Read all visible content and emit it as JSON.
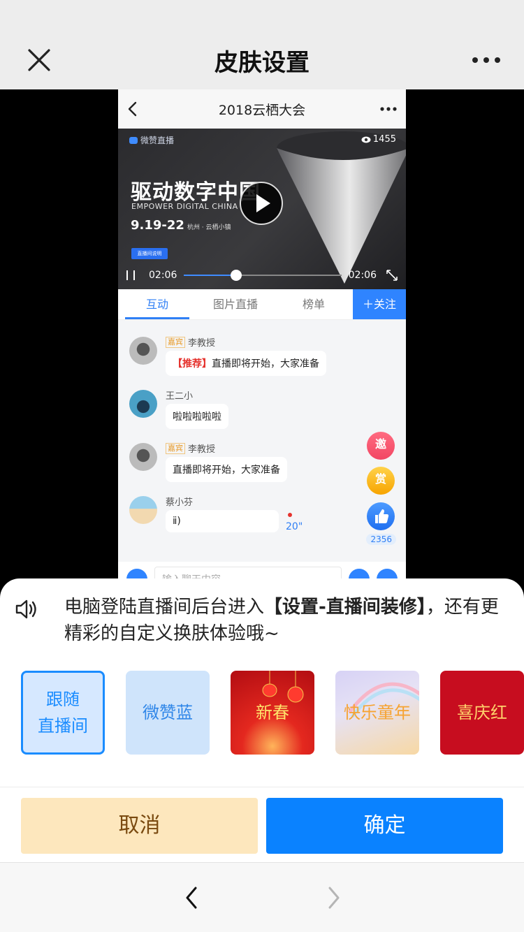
{
  "nav": {
    "title": "皮肤设置"
  },
  "preview": {
    "title": "2018云栖大会",
    "video": {
      "brand": "微赞直播",
      "viewers": "1455",
      "headline": "驱动数字中国",
      "subtitle_en": "EMPOWER DIGITAL CHINA",
      "date": "9.19-22",
      "location": "杭州 · 云栖小镇",
      "tag_button": "直播间说明",
      "time_current": "02:06",
      "time_total": "02:06",
      "progress": 0.33
    },
    "tabs": [
      {
        "label": "互动",
        "active": true
      },
      {
        "label": "图片直播",
        "active": false
      },
      {
        "label": "榜单",
        "active": false
      }
    ],
    "follow_label": "＋关注",
    "messages": [
      {
        "badge": "嘉宾",
        "name": "李教授",
        "tag": "【推荐】",
        "text": "直播即将开始，大家准备"
      },
      {
        "badge": "",
        "name": "王二小",
        "tag": "",
        "text": "啦啦啦啦啦"
      },
      {
        "badge": "嘉宾",
        "name": "李教授",
        "tag": "",
        "text": "直播即将开始，大家准备"
      },
      {
        "badge": "",
        "name": "蔡小芬",
        "tag": "",
        "text": "ⅱ)"
      }
    ],
    "voice_length": "20\"",
    "side": {
      "invite": "邀",
      "reward": "赏",
      "likes": "2356"
    },
    "input_placeholder": "输入聊天内容"
  },
  "notice": {
    "prefix": "电脑登陆直播间后台进入",
    "bold": "【设置-直播间装修】",
    "suffix": "，还有更精彩的自定义换肤体验哦~"
  },
  "skins": [
    {
      "label_line1": "跟随",
      "label_line2": "直播间",
      "selected": true
    },
    {
      "label_line1": "微赞蓝",
      "label_line2": "",
      "selected": false
    },
    {
      "label_line1": "新春",
      "label_line2": "",
      "selected": false
    },
    {
      "label_line1": "快乐童年",
      "label_line2": "",
      "selected": false
    },
    {
      "label_line1": "喜庆红",
      "label_line2": "",
      "selected": false
    }
  ],
  "actions": {
    "cancel": "取消",
    "confirm": "确定"
  },
  "colors": {
    "accent": "#0a82ff",
    "cancel_bg": "#fde7bd",
    "cancel_text": "#7a4a10"
  }
}
